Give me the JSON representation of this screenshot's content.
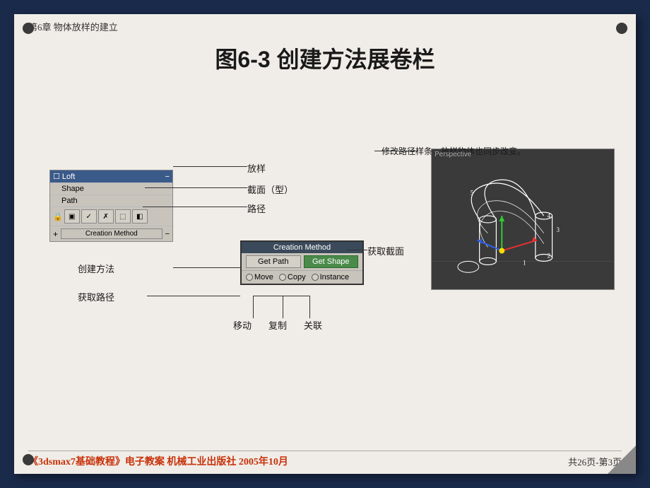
{
  "page": {
    "background_color": "#1a2a4a",
    "paper_color": "#f0ede8"
  },
  "header": {
    "chapter": "第6章   物体放样的建立",
    "title": "图6-3 创建方法展卷栏"
  },
  "ui_panel": {
    "title": "Loft",
    "rows": [
      "Shape",
      "Path"
    ],
    "creation_method_label": "Creation Method",
    "plus_label": "+"
  },
  "popup": {
    "title": "Creation Method",
    "get_path_label": "Get Path",
    "get_shape_label": "Get Shape",
    "move_label": "Move",
    "copy_label": "Copy",
    "instance_label": "Instance"
  },
  "annotations": {
    "fangyang": "放样",
    "jiemian": "截面（型）",
    "lujing": "路径",
    "chuangjianfangfa": "创建方法",
    "huoqulujing": "获取路径",
    "huoqujiemian": "获取截面",
    "yidong": "移动",
    "fuzhi": "复制",
    "guanlian": "关联",
    "xiugai": "修改路径样条，放样物体也同步改变。"
  },
  "perspective": {
    "label": "Perspective"
  },
  "footer": {
    "left": "《3dsmax7基础教程》电子教案  机械工业出版社  2005年10月",
    "right": "共26页-第3页"
  }
}
